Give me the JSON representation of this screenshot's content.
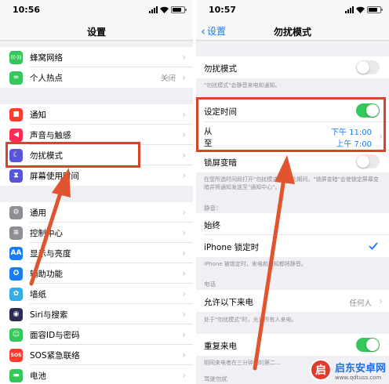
{
  "left": {
    "status_time": "10:56",
    "title": "设置",
    "rows": [
      {
        "label": "蜂窝网络",
        "icon": "antenna-icon",
        "color": "#34c759",
        "glyph": "((·))",
        "value": ""
      },
      {
        "label": "个人热点",
        "icon": "hotspot-icon",
        "color": "#34c759",
        "glyph": "∞",
        "value": "关闭"
      },
      {
        "label": "通知",
        "icon": "notification-icon",
        "color": "#ff3b30",
        "glyph": "■",
        "value": ""
      },
      {
        "label": "声音与触感",
        "icon": "speaker-icon",
        "color": "#ff2d55",
        "glyph": "◀",
        "value": ""
      },
      {
        "label": "勿扰模式",
        "icon": "moon-icon",
        "color": "#5856d6",
        "glyph": "☾",
        "value": ""
      },
      {
        "label": "屏幕使用时间",
        "icon": "hourglass-icon",
        "color": "#5856d6",
        "glyph": "⧗",
        "value": ""
      },
      {
        "label": "通用",
        "icon": "gear-icon",
        "color": "#8e8e93",
        "glyph": "⚙",
        "value": ""
      },
      {
        "label": "控制中心",
        "icon": "sliders-icon",
        "color": "#8e8e93",
        "glyph": "≡",
        "value": ""
      },
      {
        "label": "显示与亮度",
        "icon": "display-icon",
        "color": "#1a7cf5",
        "glyph": "AA",
        "value": ""
      },
      {
        "label": "辅助功能",
        "icon": "accessibility-icon",
        "color": "#1a7cf5",
        "glyph": "✪",
        "value": ""
      },
      {
        "label": "墙纸",
        "icon": "wallpaper-icon",
        "color": "#32ade6",
        "glyph": "✿",
        "value": ""
      },
      {
        "label": "Siri与搜索",
        "icon": "siri-icon",
        "color": "#2c2c54",
        "glyph": "◉",
        "value": ""
      },
      {
        "label": "面容ID与密码",
        "icon": "faceid-icon",
        "color": "#34c759",
        "glyph": "☺",
        "value": ""
      },
      {
        "label": "SOS紧急联络",
        "icon": "sos-icon",
        "color": "#ff3b30",
        "glyph": "SOS",
        "value": ""
      },
      {
        "label": "电池",
        "icon": "battery-icon",
        "color": "#34c759",
        "glyph": "▬",
        "value": ""
      }
    ]
  },
  "right": {
    "status_time": "10:57",
    "back_label": "设置",
    "title": "勿扰模式",
    "dnd_label": "勿扰模式",
    "dnd_note": "\"勿扰模式\"会静音来电和通知。",
    "scheduled_label": "设定时间",
    "from_label": "从",
    "to_label": "至",
    "from_time": "下午 11:00",
    "to_time": "上午 7:00",
    "dim_label": "锁屏变暗",
    "dim_note": "在您所选时间段打开\"勿扰模式\"，在此期间，\"锁屏变暗\"会使锁定屏幕变暗并将通知发送至\"通知中心\"。",
    "silence_header": "静音：",
    "always_label": "始终",
    "locked_label": "iPhone 锁定时",
    "locked_note": "iPhone 被锁定时，来电和通知都将静音。",
    "phone_header": "电话",
    "allow_calls_label": "允许以下来电",
    "allow_calls_value": "任何人",
    "allow_calls_note": "处于\"勿扰模式\"时，允许所有人来电。",
    "repeat_label": "重复来电",
    "repeat_note": "相同来电者在三分钟内的第二...",
    "drive_header": "驾驶勿扰"
  },
  "watermark": {
    "title": "启东安卓网",
    "url": "www.qdtuss.com",
    "glyph": "启"
  },
  "colors": {
    "accent": "#1a7cf5",
    "highlight_red": "#d8432c",
    "toggle_on": "#34c759"
  }
}
